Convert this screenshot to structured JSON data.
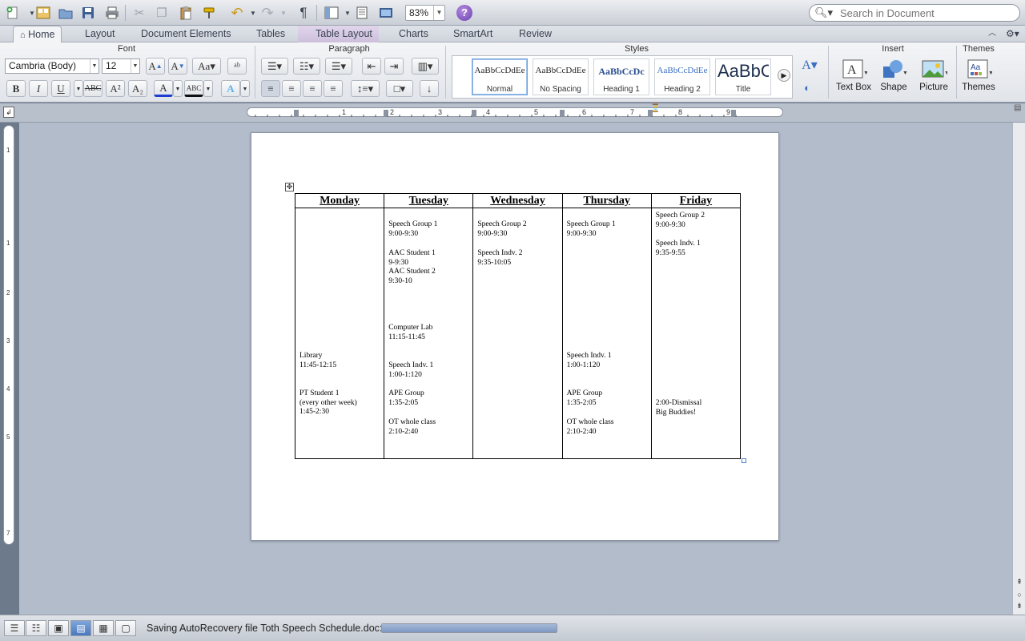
{
  "toolbar": {
    "zoom_value": "83%",
    "help_label": "?",
    "search_placeholder": "Search in Document"
  },
  "ribbon_tabs": [
    {
      "label": "Home"
    },
    {
      "label": "Layout"
    },
    {
      "label": "Document Elements"
    },
    {
      "label": "Tables"
    },
    {
      "label": "Table Layout"
    },
    {
      "label": "Charts"
    },
    {
      "label": "SmartArt"
    },
    {
      "label": "Review"
    }
  ],
  "ribbon": {
    "groups": {
      "font": "Font",
      "paragraph": "Paragraph",
      "styles": "Styles",
      "insert": "Insert",
      "themes": "Themes"
    },
    "font_name": "Cambria (Body)",
    "font_size": "12",
    "styles": [
      {
        "sample": "AaBbCcDdEe",
        "label": "Normal"
      },
      {
        "sample": "AaBbCcDdEe",
        "label": "No Spacing"
      },
      {
        "sample": "AaBbCcDc",
        "label": "Heading 1"
      },
      {
        "sample": "AaBbCcDdEe",
        "label": "Heading 2"
      },
      {
        "sample": "AaBbC",
        "label": "Title"
      }
    ],
    "insert_items": [
      {
        "label": "Text Box"
      },
      {
        "label": "Shape"
      },
      {
        "label": "Picture"
      }
    ],
    "themes_label": "Themes"
  },
  "ruler": {
    "h_numbers": [
      "1",
      "2",
      "3",
      "4",
      "5",
      "6",
      "7",
      "8",
      "9"
    ],
    "v_numbers": [
      "1",
      "1",
      "2",
      "3",
      "4",
      "5",
      "7"
    ]
  },
  "schedule": {
    "days": [
      "Monday",
      "Tuesday",
      "Wednesday",
      "Thursday",
      "Friday"
    ],
    "entries": {
      "monday": [
        {
          "line1": "Library",
          "line2": "11:45-12:15"
        },
        {
          "line1": "PT Student 1",
          "line2": "(every other week)",
          "line3": "1:45-2:30"
        }
      ],
      "tuesday": [
        {
          "line1": "Speech Group 1",
          "line2": "9:00-9:30"
        },
        {
          "line1": "AAC Student 1",
          "line2": "9-9:30"
        },
        {
          "line1": "AAC Student 2",
          "line2": "9:30-10"
        },
        {
          "line1": "Computer Lab",
          "line2": "11:15-11:45"
        },
        {
          "line1": "Speech Indv. 1",
          "line2": "1:00-1:120"
        },
        {
          "line1": "APE Group",
          "line2": "1:35-2:05"
        },
        {
          "line1": "OT whole class",
          "line2": "2:10-2:40"
        }
      ],
      "wednesday": [
        {
          "line1": "Speech Group 2",
          "line2": "9:00-9:30"
        },
        {
          "line1": "Speech Indv. 2",
          "line2": "9:35-10:05"
        }
      ],
      "thursday": [
        {
          "line1": "Speech Group 1",
          "line2": "9:00-9:30"
        },
        {
          "line1": "Speech Indv. 1",
          "line2": "1:00-1:120"
        },
        {
          "line1": "APE Group",
          "line2": "1:35-2:05"
        },
        {
          "line1": "OT whole class",
          "line2": "2:10-2:40"
        }
      ],
      "friday": [
        {
          "line1": "Speech Group 2",
          "line2": "9:00-9:30"
        },
        {
          "line1": "Speech Indv. 1",
          "line2": "9:35-9:55"
        },
        {
          "line1": "2:00-Dismissal",
          "line2": "Big Buddies!"
        }
      ]
    }
  },
  "status": {
    "message": "Saving AutoRecovery file Toth Speech Schedule.doc:",
    "progress": 1.0
  },
  "colors": {
    "accent": "#4a78bd",
    "context_tab": "#cdbfdc",
    "doc_background": "#b3bccb"
  }
}
